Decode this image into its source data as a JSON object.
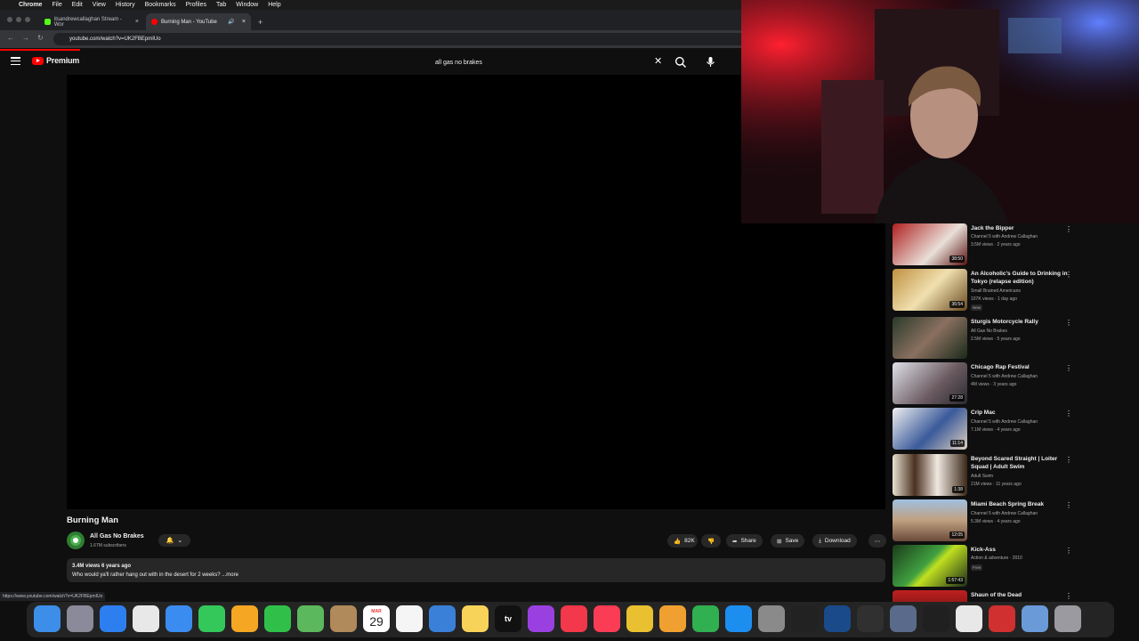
{
  "menubar": {
    "apple": "",
    "app": "Chrome",
    "items": [
      "File",
      "Edit",
      "View",
      "History",
      "Bookmarks",
      "Profiles",
      "Tab",
      "Window",
      "Help"
    ]
  },
  "tabs": [
    {
      "label": "itsandrewcallaghan Stream - Wor",
      "active": false
    },
    {
      "label": "Burning Man - YouTube",
      "active": true
    }
  ],
  "address": {
    "url": "youtube.com/watch?v=UK2FBEpmIUo"
  },
  "youtube": {
    "logo_text": "Premium",
    "search_value": "all gas no brakes"
  },
  "video": {
    "title": "Burning Man",
    "channel": "All Gas No Brakes",
    "subscribers": "1.67M subscribers",
    "likes": "82K",
    "share": "Share",
    "save": "Save",
    "download": "Download",
    "views_age": "3.4M views  6 years ago",
    "description": "Who would ya'll rather hang out with in the desert for 2 weeks? ...more"
  },
  "status_url": "https://www.youtube.com/watch?v=UK2FBEpmIUo",
  "recommendations": [
    {
      "title": "Jack the Bipper",
      "channel": "Channel 5 with Andrew Callaghan",
      "views": "3.5M views · 2 years ago",
      "duration": "38:50",
      "badge": "",
      "thumb": "#8c1a1a"
    },
    {
      "title": "An Alcoholic's Guide to Drinking in Tokyo (relapse edition)",
      "channel": "Small Brained Americans",
      "views": "107K views · 1 day ago",
      "duration": "36:54",
      "badge": "New",
      "thumb": "#8a6a2a"
    },
    {
      "title": "Sturgis Motorcycle Rally",
      "channel": "All Gas No Brakes",
      "views": "2.5M views · 5 years ago",
      "duration": "",
      "badge": "",
      "thumb": "#3a4a3a"
    },
    {
      "title": "Chicago Rap Festival",
      "channel": "Channel 5 with Andrew Callaghan",
      "views": "4M views · 3 years ago",
      "duration": "27:28",
      "badge": "",
      "thumb": "#5a5a6a"
    },
    {
      "title": "Crip Mac",
      "channel": "Channel 5 with Andrew Callaghan",
      "views": "7.1M views · 4 years ago",
      "duration": "11:14",
      "badge": "",
      "thumb": "#3a5a8a"
    },
    {
      "title": "Beyond Scared Straight | Loiter Squad | Adult Swim",
      "channel": "Adult Swim",
      "views": "21M views · 11 years ago",
      "duration": "1:38",
      "badge": "",
      "thumb": "#c8b8a0"
    },
    {
      "title": "Miami Beach Spring Break",
      "channel": "Channel 5 with Andrew Callaghan",
      "views": "5.3M views · 4 years ago",
      "duration": "12:05",
      "badge": "",
      "thumb": "#6a8aa0"
    },
    {
      "title": "Kick-Ass",
      "channel": "Action & adventure · 2010",
      "views": "",
      "duration": "1:57:43",
      "badge": "Free",
      "thumb": "#2a4a2a"
    },
    {
      "title": "Shaun of the Dead",
      "channel": "",
      "views": "",
      "duration": "",
      "badge": "",
      "thumb": "#6a1a1a"
    }
  ],
  "dock": {
    "calendar_month": "MAR",
    "calendar_day": "29",
    "tv_label": "tv",
    "items": [
      {
        "name": "finder-icon",
        "color": "#3c8ee8"
      },
      {
        "name": "launchpad-icon",
        "color": "#8a8a9a"
      },
      {
        "name": "safari-icon",
        "color": "#2d7ff0"
      },
      {
        "name": "chrome-icon",
        "color": "#e8e8e8"
      },
      {
        "name": "mail-icon",
        "color": "#3b8cf0"
      },
      {
        "name": "messages-icon",
        "color": "#34c759"
      },
      {
        "name": "photos-icon",
        "color": "#f5a623"
      },
      {
        "name": "facetime-icon",
        "color": "#30c04a"
      },
      {
        "name": "maps-icon",
        "color": "#5cb85c"
      },
      {
        "name": "contacts-icon",
        "color": "#b08a5a"
      },
      {
        "name": "calendar-icon",
        "color": "#ffffff"
      },
      {
        "name": "reminders-icon",
        "color": "#f5f5f5"
      },
      {
        "name": "keynote-icon",
        "color": "#3a7fd8"
      },
      {
        "name": "notes-icon",
        "color": "#f7d35a"
      },
      {
        "name": "apple-tv-icon",
        "color": "#111111"
      },
      {
        "name": "podcasts-icon",
        "color": "#9b40e0"
      },
      {
        "name": "news-icon",
        "color": "#f2384a"
      },
      {
        "name": "music-icon",
        "color": "#fa3c55"
      },
      {
        "name": "instruments-icon",
        "color": "#e8c030"
      },
      {
        "name": "pages-icon",
        "color": "#f0a030"
      },
      {
        "name": "numbers-icon",
        "color": "#30b050"
      },
      {
        "name": "app-store-icon",
        "color": "#1c8ef0"
      },
      {
        "name": "system-settings-icon",
        "color": "#8a8a8a"
      },
      {
        "name": "final-cut-icon",
        "color": "#222222"
      },
      {
        "name": "quicktime-icon",
        "color": "#1a4a8a"
      },
      {
        "name": "obs-icon",
        "color": "#303030"
      },
      {
        "name": "screenshot-icon",
        "color": "#5a6a8a"
      },
      {
        "name": "script-editor-icon",
        "color": "#202020"
      },
      {
        "name": "document-icon",
        "color": "#e8e8e8"
      },
      {
        "name": "pdf-icon",
        "color": "#d03030"
      },
      {
        "name": "folder-icon",
        "color": "#6a9ad8"
      },
      {
        "name": "trash-icon",
        "color": "#9a9aa0"
      }
    ]
  }
}
